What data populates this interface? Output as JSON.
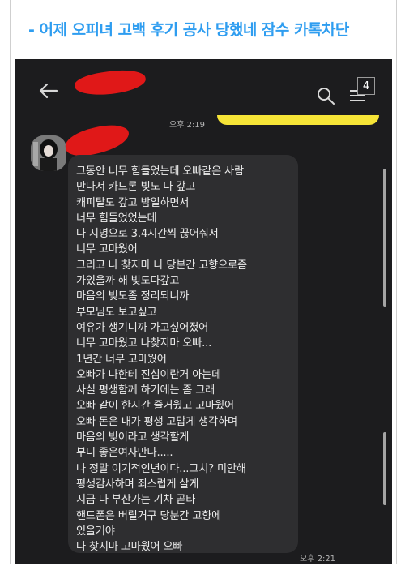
{
  "title": "- 어제 오피녀 고백 후기 공사 당했네 잠수 카톡차단",
  "chat": {
    "unread_count": "4",
    "time_top": "오후 2:19",
    "time_bottom": "오후 2:21",
    "message_lines": [
      "그동안 너무 힘들었는데 오빠같은 사람",
      "만나서 카드론 빚도 다 갚고",
      "캐피탈도 갚고 밤일하면서",
      "너무 힘들었었는데",
      "나 지명으로 3.4시간씩 끊어줘서",
      "너무 고마웠어",
      "그리고  나 찾지마 나 당분간 고향으로좀",
      "가있을까 해 빚도다갚고",
      "마음의 빚도좀 정리되니까",
      "부모님도 보고싶고",
      "여유가 생기니까 가고싶어졌어",
      "너무 고마웠고 나찾지마 오빠...",
      "1년간 너무 고마웠어",
      "오빠가 나한테 진심이란거 아는데",
      "사실 평생함께 하기에는 좀 그래",
      "오빠 같이 한시간 즐거웠고 고마웠어",
      "오빠 돈은 내가 평생 고맙게 생각하며",
      "마음의 빚이라고 생각할게",
      "부디 좋은여자만나.....",
      "나 정말 이기적인년이다...그치? 미안해",
      "평생감사하며 죄스럽게 살게",
      "지금 나 부산가는 기차 곧타",
      "핸드폰은 버릴거구 당분간 고향에",
      "있을거야",
      "나 찾지마 고마웠어 오빠"
    ]
  },
  "colors": {
    "title": "#2e9df0",
    "background_dark": "#1c1c1e",
    "bubble": "#2e2e30",
    "bubble_text": "#ececec",
    "redaction": "#e01818",
    "my_bubble": "#f6e437"
  },
  "icons": [
    "back-arrow-icon",
    "search-icon",
    "menu-icon"
  ]
}
